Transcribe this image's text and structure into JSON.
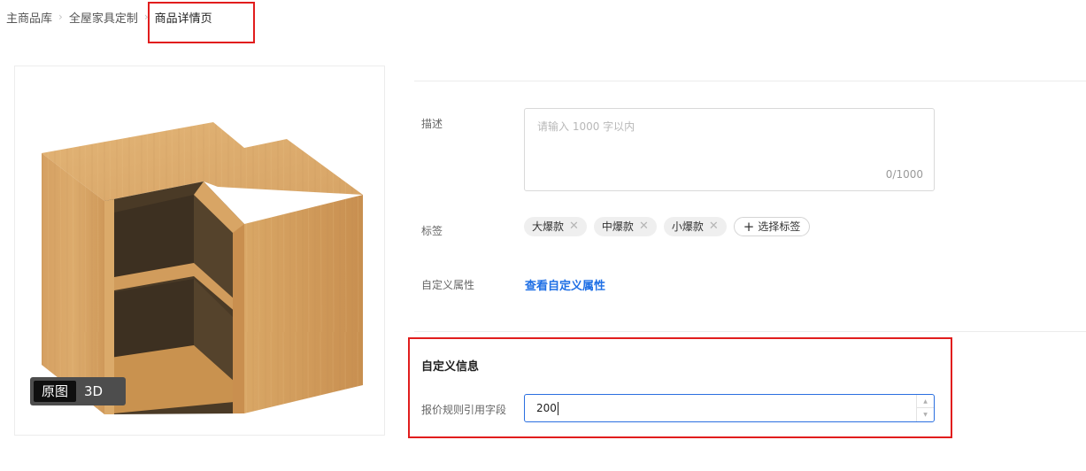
{
  "breadcrumb": {
    "items": [
      "主商品库",
      "全屋家具定制",
      "商品详情页"
    ],
    "separator": "›"
  },
  "image_viewer": {
    "toggle": [
      "原图",
      "3D"
    ],
    "active": "原图"
  },
  "form": {
    "description": {
      "label": "描述",
      "placeholder": "请输入 1000 字以内",
      "counter": "0/1000"
    },
    "tags": {
      "label": "标签",
      "items": [
        "大爆款",
        "中爆款",
        "小爆款"
      ],
      "add_label": "选择标签"
    },
    "custom_attrs": {
      "label": "自定义属性",
      "link": "查看自定义属性"
    }
  },
  "custom_info": {
    "title": "自定义信息",
    "field_label": "报价规则引用字段",
    "field_value": "200"
  },
  "colors": {
    "accent": "#1f6fe5",
    "highlight": "#e11d1d",
    "wood": "#d9a262"
  }
}
